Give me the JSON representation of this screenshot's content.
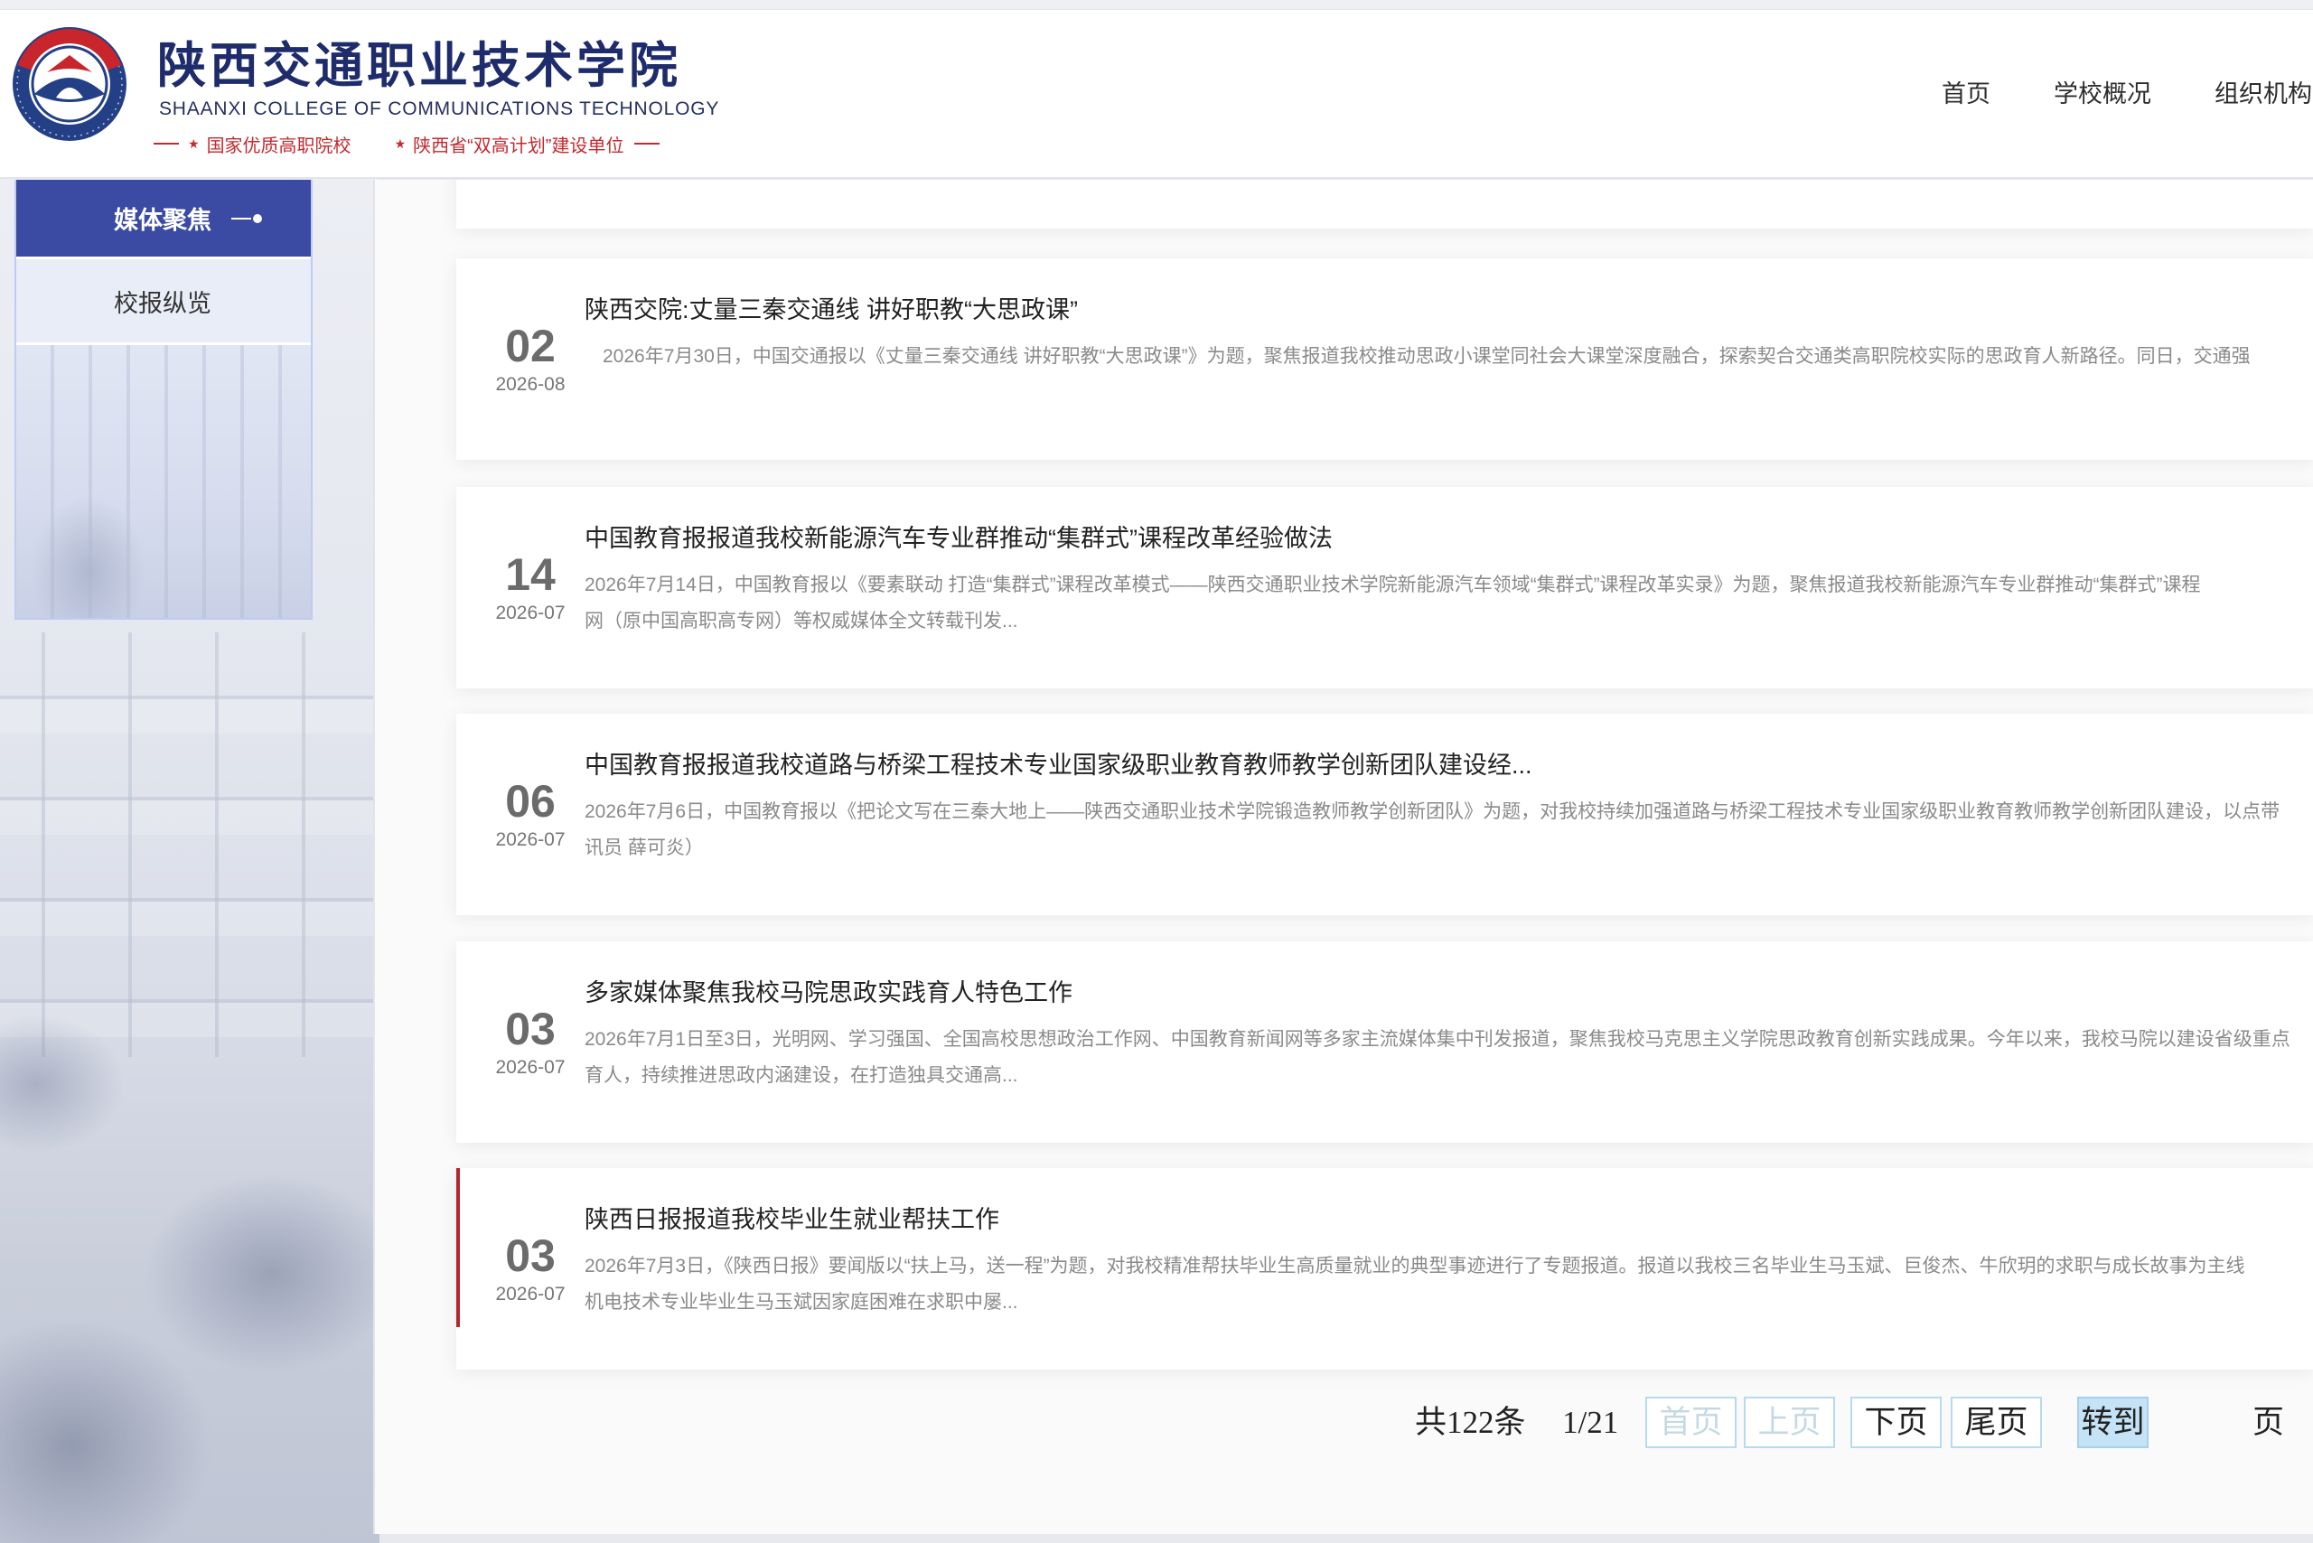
{
  "header": {
    "school_name_cn": "陕西交通职业技术学院",
    "school_name_en": "SHAANXI COLLEGE OF COMMUNICATIONS TECHNOLOGY",
    "tagline_left": "国家优质高职院校",
    "tagline_right": "陕西省“双高计划”建设单位",
    "star_icon": "★"
  },
  "nav": [
    {
      "label": "首页"
    },
    {
      "label": "学校概况"
    },
    {
      "label": "组织机构"
    }
  ],
  "sidebar": {
    "items": [
      {
        "label": "媒体聚焦",
        "active": true
      },
      {
        "label": "校报纵览",
        "active": false
      }
    ]
  },
  "articles": [
    {
      "day": "02",
      "month": "2026-08",
      "title": "陕西交院:丈量三秦交通线 讲好职教“大思政课”",
      "summary_lines": [
        "2026年7月30日，中国交通报以《丈量三秦交通线 讲好职教“大思政课”》为题，聚焦报道我校推动思政小课堂同社会大课堂深度融合，探索契合交通类高职院校实际的思政育人新路径。同日，交通强"
      ]
    },
    {
      "day": "14",
      "month": "2026-07",
      "title": "中国教育报报道我校新能源汽车专业群推动“集群式”课程改革经验做法",
      "summary_lines": [
        "2026年7月14日，中国教育报以《要素联动 打造“集群式”课程改革模式——陕西交通职业技术学院新能源汽车领域“集群式”课程改革实录》为题，聚焦报道我校新能源汽车专业群推动“集群式”课程",
        "网（原中国高职高专网）等权威媒体全文转载刊发..."
      ]
    },
    {
      "day": "06",
      "month": "2026-07",
      "title": "中国教育报报道我校道路与桥梁工程技术专业国家级职业教育教师教学创新团队建设经...",
      "summary_lines": [
        "2026年7月6日，中国教育报以《把论文写在三秦大地上——陕西交通职业技术学院锻造教师教学创新团队》为题，对我校持续加强道路与桥梁工程技术专业国家级职业教育教师教学创新团队建设，以点带",
        "讯员 薛可炎）"
      ]
    },
    {
      "day": "03",
      "month": "2026-07",
      "title": "多家媒体聚焦我校马院思政实践育人特色工作",
      "summary_lines": [
        "2026年7月1日至3日，光明网、学习强国、全国高校思想政治工作网、中国教育新闻网等多家主流媒体集中刊发报道，聚焦我校马克思主义学院思政教育创新实践成果。今年以来，我校马院以建设省级重点",
        "育人，持续推进思政内涵建设，在打造独具交通高..."
      ]
    },
    {
      "day": "03",
      "month": "2026-07",
      "title": "陕西日报报道我校毕业生就业帮扶工作",
      "summary_lines": [
        "2026年7月3日，《陕西日报》要闻版以“扶上马，送一程”为题，对我校精准帮扶毕业生高质量就业的典型事迹进行了专题报道。报道以我校三名毕业生马玉斌、巨俊杰、牛欣玥的求职与成长故事为主线",
        "机电技术专业毕业生马玉斌因家庭困难在求职中屡..."
      ],
      "highlighted": true
    }
  ],
  "pagination": {
    "total": "共122条",
    "page": "1/21",
    "first": "首页",
    "prev": "上页",
    "next": "下页",
    "last": "尾页",
    "goto": "转到",
    "page_unit": "页",
    "goto_value": "",
    "first_disabled": true,
    "prev_disabled": true
  },
  "colors": {
    "sidebar_active": "#3b4aa3",
    "brand_blue": "#1f2c6c",
    "accent_red": "#c22a2f",
    "pager_border": "#b7dbee",
    "pager_goto_bg": "#c5e3f6"
  }
}
